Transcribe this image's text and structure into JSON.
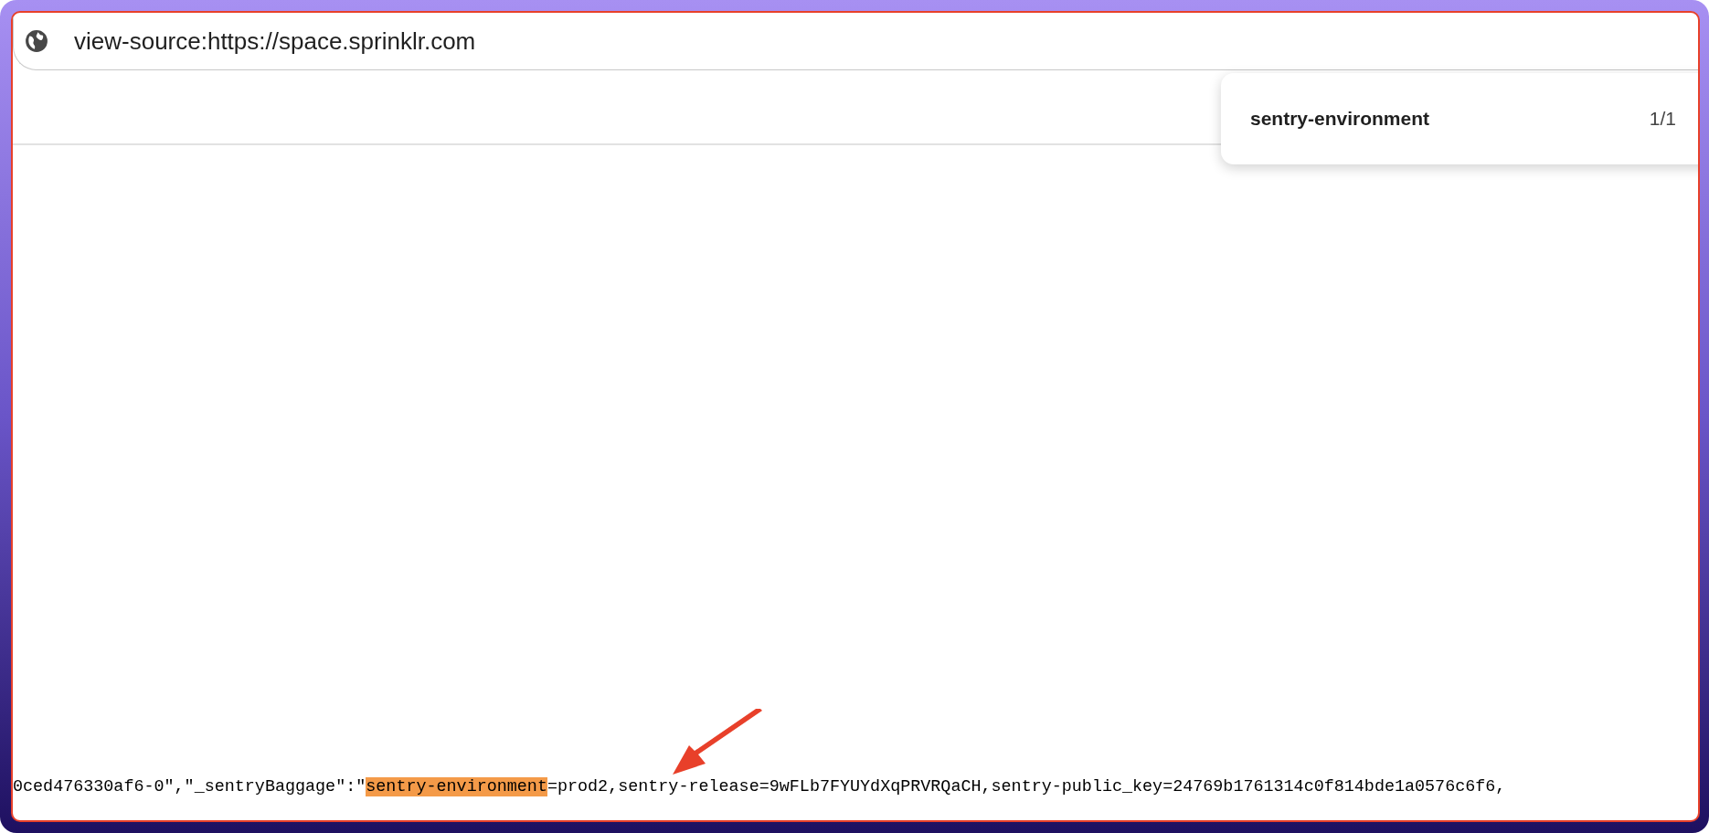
{
  "address_bar": {
    "url": "view-source:https://space.sprinklr.com"
  },
  "find_bar": {
    "query": "sentry-environment",
    "count": "1/1"
  },
  "source_line": [
    {
      "text": "0ced476330af6-0\",\"_sentryBaggage\":\"",
      "highlighted": false
    },
    {
      "text": "sentry-environment",
      "highlighted": true
    },
    {
      "text": "=prod2,sentry-release=9wFLb7FYUYdXqPRVRQaCH,sentry-public_key=24769b1761314c0f814bde1a0576c6f6,",
      "highlighted": false
    }
  ]
}
